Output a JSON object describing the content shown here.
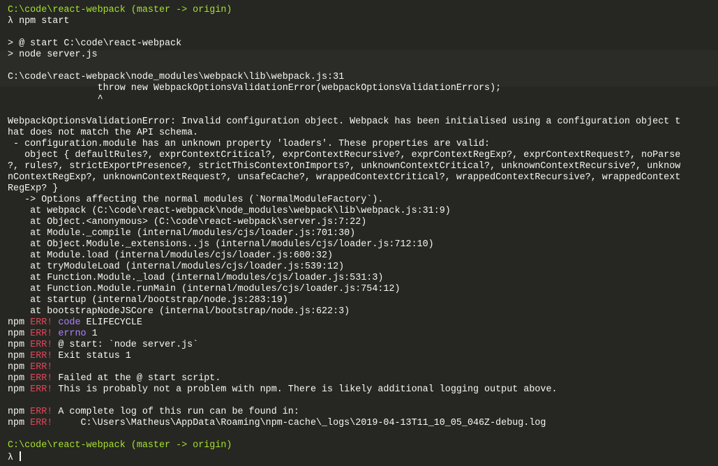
{
  "theme": {
    "background": "#262722",
    "text": "#f8f8f2",
    "prompt_color": "#a6e22e",
    "err_color": "#e0475a",
    "key_color": "#ae81ff"
  },
  "terminal": {
    "lines": [
      [
        {
          "t": "C:\\code\\react-webpack",
          "c": "prompt"
        },
        {
          "t": " (master -> origin)",
          "c": "branch"
        }
      ],
      [
        {
          "t": "λ npm start",
          "c": "plain"
        }
      ],
      [],
      [
        {
          "t": "> @ start C:\\code\\react-webpack",
          "c": "plain"
        }
      ],
      [
        {
          "t": "> node server.js",
          "c": "plain"
        }
      ],
      [],
      [
        {
          "t": "C:\\code\\react-webpack\\node_modules\\webpack\\lib\\webpack.js:31",
          "c": "plain"
        }
      ],
      [
        {
          "t": "                throw new WebpackOptionsValidationError(webpackOptionsValidationErrors);",
          "c": "plain"
        }
      ],
      [
        {
          "t": "                ^",
          "c": "plain"
        }
      ],
      [],
      [
        {
          "t": "WebpackOptionsValidationError: Invalid configuration object. Webpack has been initialised using a configuration object t",
          "c": "plain"
        }
      ],
      [
        {
          "t": "hat does not match the API schema.",
          "c": "plain"
        }
      ],
      [
        {
          "t": " - configuration.module has an unknown property 'loaders'. These properties are valid:",
          "c": "plain"
        }
      ],
      [
        {
          "t": "   object { defaultRules?, exprContextCritical?, exprContextRecursive?, exprContextRegExp?, exprContextRequest?, noParse",
          "c": "plain"
        }
      ],
      [
        {
          "t": "?, rules?, strictExportPresence?, strictThisContextOnImports?, unknownContextCritical?, unknownContextRecursive?, unknow",
          "c": "plain"
        }
      ],
      [
        {
          "t": "nContextRegExp?, unknownContextRequest?, unsafeCache?, wrappedContextCritical?, wrappedContextRecursive?, wrappedContext",
          "c": "plain"
        }
      ],
      [
        {
          "t": "RegExp? }",
          "c": "plain"
        }
      ],
      [
        {
          "t": "   -> Options affecting the normal modules (`NormalModuleFactory`).",
          "c": "plain"
        }
      ],
      [
        {
          "t": "    at webpack (C:\\code\\react-webpack\\node_modules\\webpack\\lib\\webpack.js:31:9)",
          "c": "plain"
        }
      ],
      [
        {
          "t": "    at Object.<anonymous> (C:\\code\\react-webpack\\server.js:7:22)",
          "c": "plain"
        }
      ],
      [
        {
          "t": "    at Module._compile (internal/modules/cjs/loader.js:701:30)",
          "c": "plain"
        }
      ],
      [
        {
          "t": "    at Object.Module._extensions..js (internal/modules/cjs/loader.js:712:10)",
          "c": "plain"
        }
      ],
      [
        {
          "t": "    at Module.load (internal/modules/cjs/loader.js:600:32)",
          "c": "plain"
        }
      ],
      [
        {
          "t": "    at tryModuleLoad (internal/modules/cjs/loader.js:539:12)",
          "c": "plain"
        }
      ],
      [
        {
          "t": "    at Function.Module._load (internal/modules/cjs/loader.js:531:3)",
          "c": "plain"
        }
      ],
      [
        {
          "t": "    at Function.Module.runMain (internal/modules/cjs/loader.js:754:12)",
          "c": "plain"
        }
      ],
      [
        {
          "t": "    at startup (internal/bootstrap/node.js:283:19)",
          "c": "plain"
        }
      ],
      [
        {
          "t": "    at bootstrapNodeJSCore (internal/bootstrap/node.js:622:3)",
          "c": "plain"
        }
      ],
      [
        {
          "t": "npm ",
          "c": "plain"
        },
        {
          "t": "ERR!",
          "c": "err"
        },
        {
          "t": " ",
          "c": "plain"
        },
        {
          "t": "code",
          "c": "key"
        },
        {
          "t": " ELIFECYCLE",
          "c": "plain"
        }
      ],
      [
        {
          "t": "npm ",
          "c": "plain"
        },
        {
          "t": "ERR!",
          "c": "err"
        },
        {
          "t": " ",
          "c": "plain"
        },
        {
          "t": "errno",
          "c": "key"
        },
        {
          "t": " 1",
          "c": "plain"
        }
      ],
      [
        {
          "t": "npm ",
          "c": "plain"
        },
        {
          "t": "ERR!",
          "c": "err"
        },
        {
          "t": " @ start: `node server.js`",
          "c": "plain"
        }
      ],
      [
        {
          "t": "npm ",
          "c": "plain"
        },
        {
          "t": "ERR!",
          "c": "err"
        },
        {
          "t": " Exit status 1",
          "c": "plain"
        }
      ],
      [
        {
          "t": "npm ",
          "c": "plain"
        },
        {
          "t": "ERR!",
          "c": "err"
        }
      ],
      [
        {
          "t": "npm ",
          "c": "plain"
        },
        {
          "t": "ERR!",
          "c": "err"
        },
        {
          "t": " Failed at the @ start script.",
          "c": "plain"
        }
      ],
      [
        {
          "t": "npm ",
          "c": "plain"
        },
        {
          "t": "ERR!",
          "c": "err"
        },
        {
          "t": " This is probably not a problem with npm. There is likely additional logging output above.",
          "c": "plain"
        }
      ],
      [],
      [
        {
          "t": "npm ",
          "c": "plain"
        },
        {
          "t": "ERR!",
          "c": "err"
        },
        {
          "t": " A complete log of this run can be found in:",
          "c": "plain"
        }
      ],
      [
        {
          "t": "npm ",
          "c": "plain"
        },
        {
          "t": "ERR!",
          "c": "err"
        },
        {
          "t": "     C:\\Users\\Matheus\\AppData\\Roaming\\npm-cache\\_logs\\2019-04-13T11_10_05_046Z-debug.log",
          "c": "plain"
        }
      ],
      [],
      [
        {
          "t": "C:\\code\\react-webpack",
          "c": "prompt"
        },
        {
          "t": " (master -> origin)",
          "c": "branch"
        }
      ],
      [
        {
          "t": "λ ",
          "c": "plain"
        }
      ]
    ]
  }
}
